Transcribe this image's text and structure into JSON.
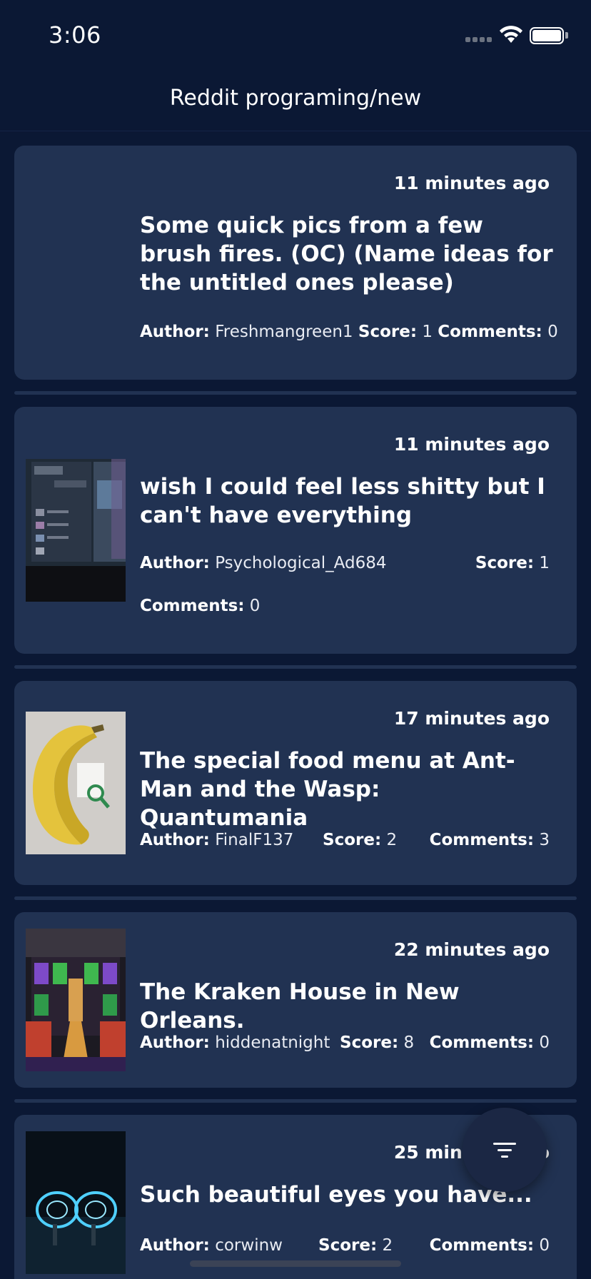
{
  "status": {
    "time": "3:06"
  },
  "nav": {
    "title": "Reddit programing/new"
  },
  "labels": {
    "author": "Author:",
    "score": "Score:",
    "comments": "Comments:"
  },
  "posts": [
    {
      "time_ago": "11 minutes ago",
      "title": "Some quick pics from a few brush fires. (OC) (Name ideas for the untitled ones please)",
      "author": "Freshmangreen1",
      "score": "1",
      "comments": "0",
      "thumbnail": "none"
    },
    {
      "time_ago": "11 minutes ago",
      "title": "wish I could feel less shitty but I can't have everything",
      "author": "Psychological_Ad684",
      "score": "1",
      "comments": "0",
      "thumbnail": "screen-photo"
    },
    {
      "time_ago": "17 minutes ago",
      "title": "The special food menu at Ant-Man and the Wasp: Quantumania",
      "author": "FinalF137",
      "score": "2",
      "comments": "3",
      "thumbnail": "banana-photo"
    },
    {
      "time_ago": "22 minutes ago",
      "title": "The Kraken House in New Orleans.",
      "author": "hiddenatnight",
      "score": "8",
      "comments": "0",
      "thumbnail": "house-photo"
    },
    {
      "time_ago": "25 minutes ago",
      "title": "Such beautiful eyes you have...",
      "author": "corwinw",
      "score": "2",
      "comments": "0",
      "thumbnail": "light-painting-photo"
    }
  ],
  "fab": {
    "icon": "filter-icon"
  },
  "colors": {
    "background": "#0b1834",
    "card": "#213252",
    "text": "#ffffff"
  }
}
